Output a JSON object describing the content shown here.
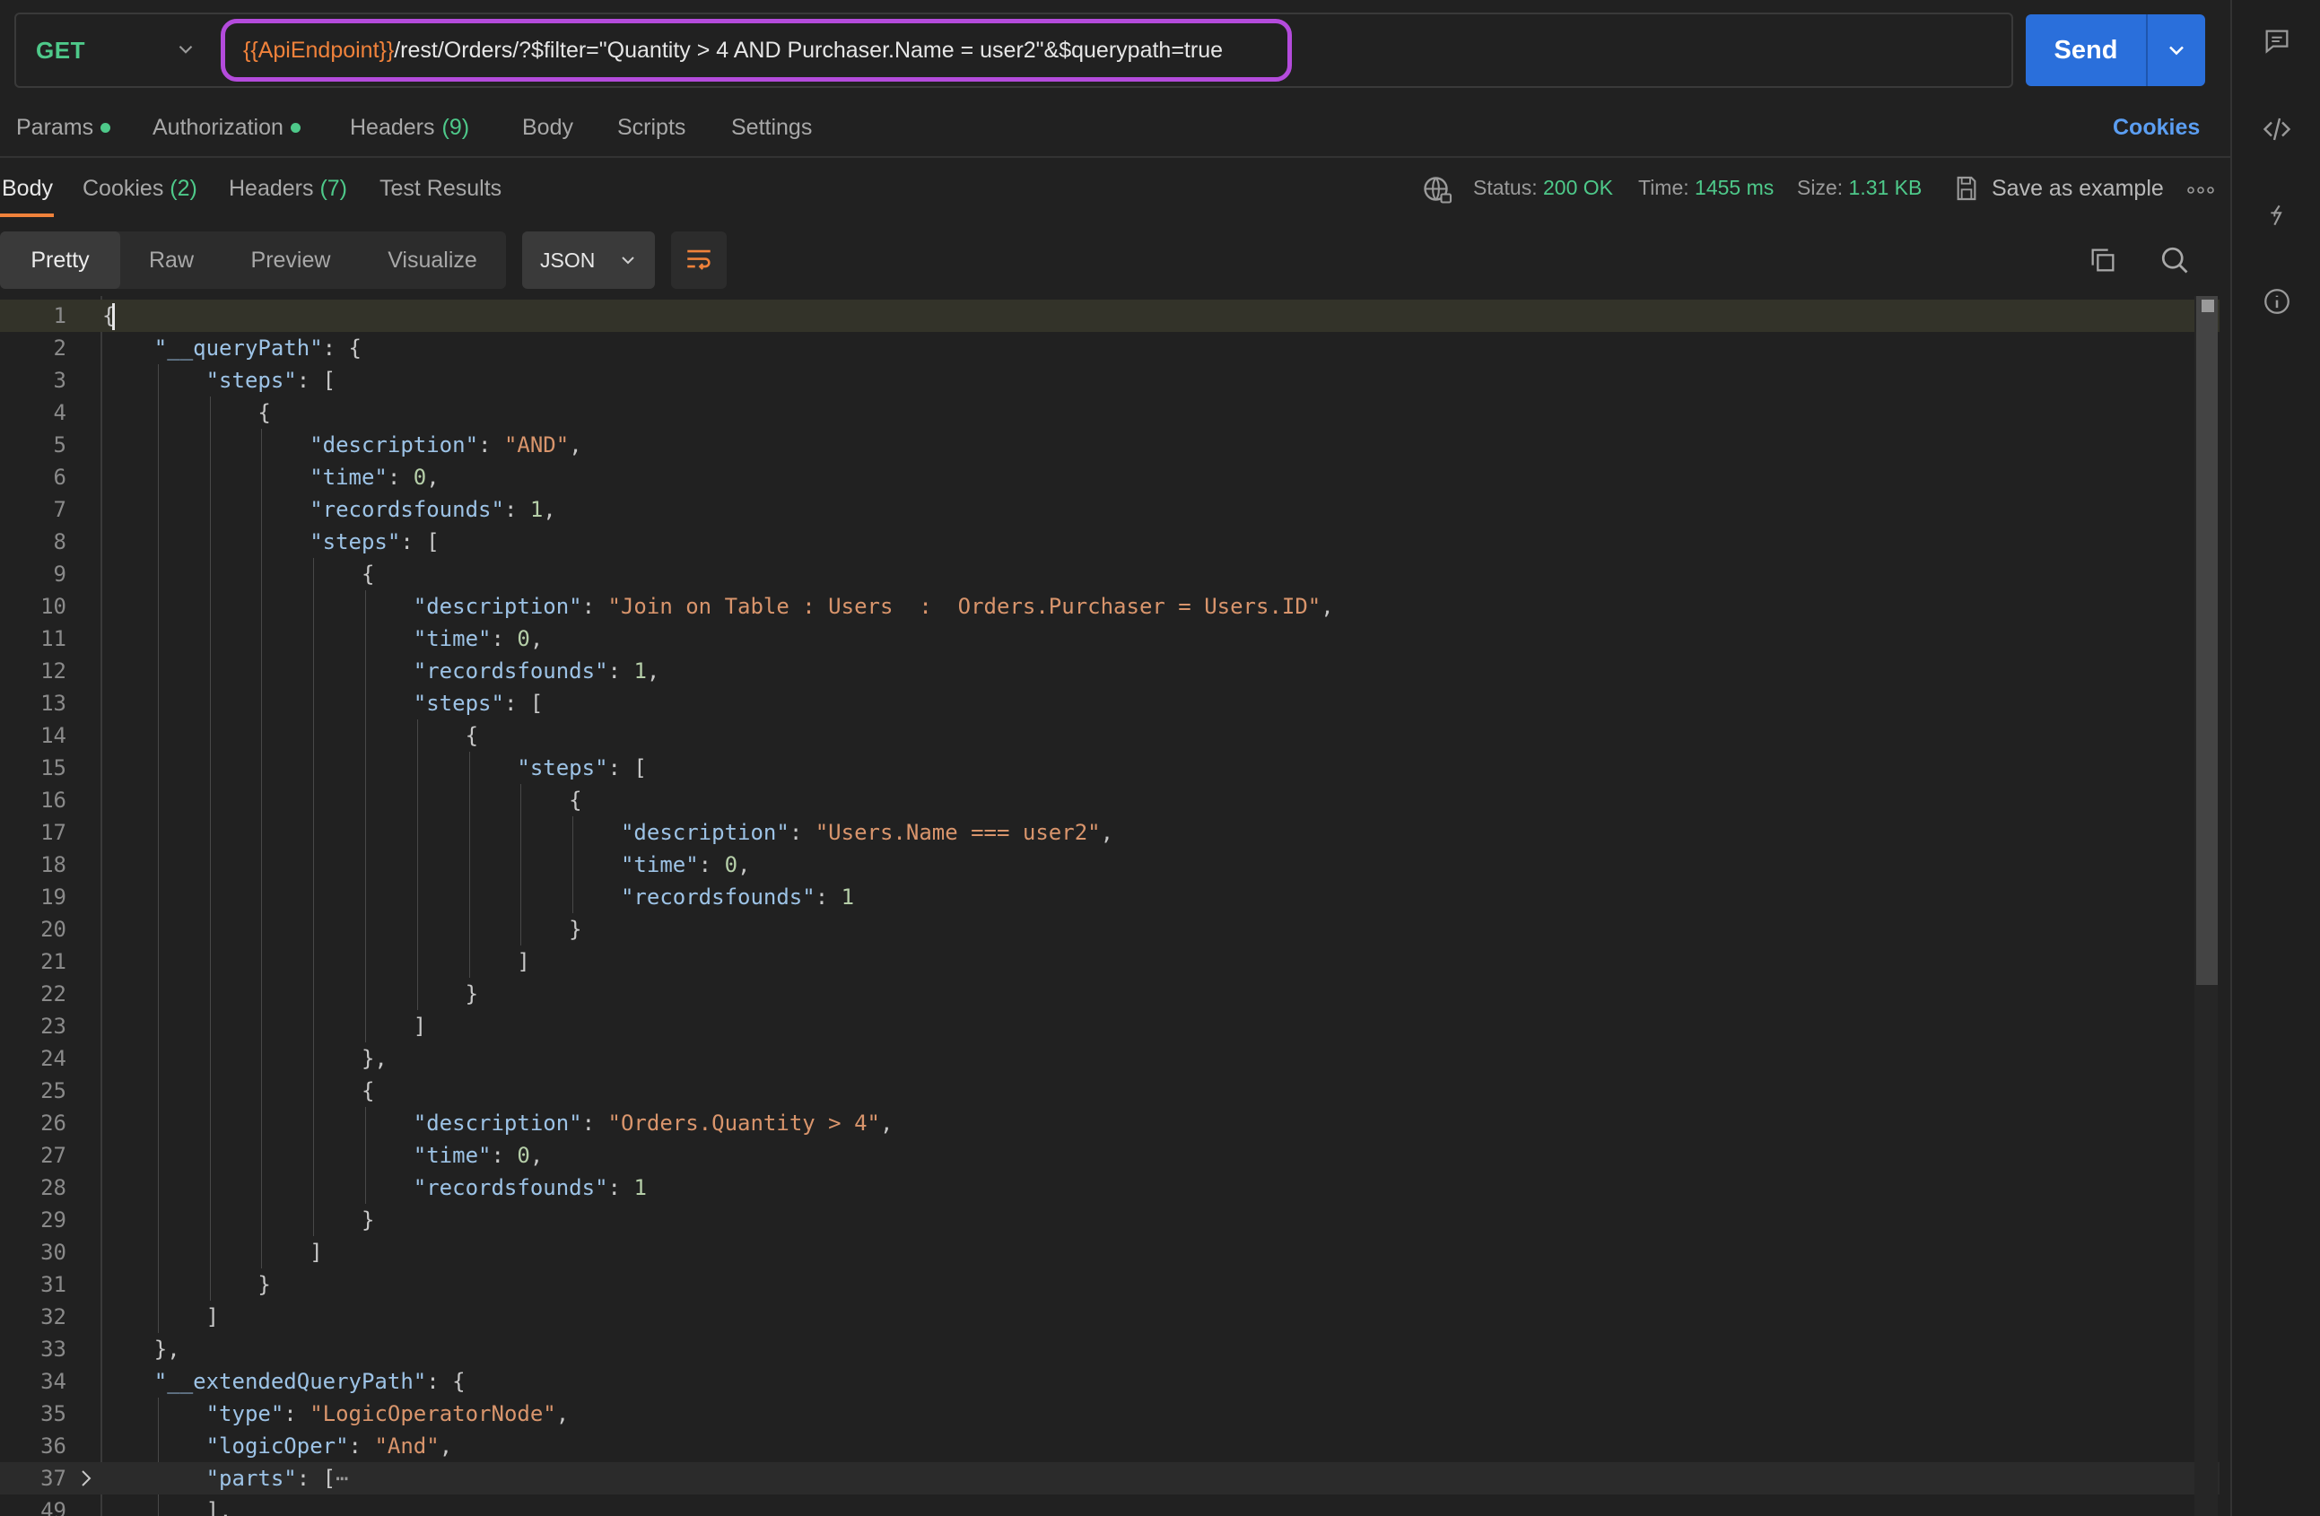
{
  "request": {
    "method": "GET",
    "url_var": "{{ApiEndpoint}}",
    "url_path": "/rest/Orders/?$filter=\"Quantity > 4 AND Purchaser.Name = user2\"&$querypath=true",
    "send_label": "Send"
  },
  "request_tabs": [
    {
      "label": "Params",
      "dot": true,
      "count": ""
    },
    {
      "label": "Authorization",
      "dot": true,
      "count": ""
    },
    {
      "label": "Headers",
      "dot": false,
      "count": "(9)"
    },
    {
      "label": "Body",
      "dot": false,
      "count": ""
    },
    {
      "label": "Scripts",
      "dot": false,
      "count": ""
    },
    {
      "label": "Settings",
      "dot": false,
      "count": ""
    }
  ],
  "cookies_link": "Cookies",
  "response_tabs": [
    {
      "label": "Body",
      "count": ""
    },
    {
      "label": "Cookies",
      "count": "(2)"
    },
    {
      "label": "Headers",
      "count": "(7)"
    },
    {
      "label": "Test Results",
      "count": ""
    }
  ],
  "status": {
    "status_label": "Status:",
    "status_value": "200 OK",
    "time_label": "Time:",
    "time_value": "1455 ms",
    "size_label": "Size:",
    "size_value": "1.31 KB",
    "save_label": "Save as example"
  },
  "view_modes": [
    "Pretty",
    "Raw",
    "Preview",
    "Visualize"
  ],
  "format": "JSON",
  "colors": {
    "accent": "#f0823b",
    "send": "#2a6fdb",
    "success": "#4ec98a",
    "highlight": "#b44bdc"
  },
  "code_lines": [
    {
      "n": "1",
      "indent": 0,
      "toks": [
        [
          "p",
          "{"
        ]
      ]
    },
    {
      "n": "2",
      "indent": 1,
      "toks": [
        [
          "k",
          "\"__queryPath\""
        ],
        [
          "p",
          ": {"
        ]
      ]
    },
    {
      "n": "3",
      "indent": 2,
      "toks": [
        [
          "k",
          "\"steps\""
        ],
        [
          "p",
          ": ["
        ]
      ]
    },
    {
      "n": "4",
      "indent": 3,
      "toks": [
        [
          "p",
          "{"
        ]
      ]
    },
    {
      "n": "5",
      "indent": 4,
      "toks": [
        [
          "k",
          "\"description\""
        ],
        [
          "p",
          ": "
        ],
        [
          "s",
          "\"AND\""
        ],
        [
          "p",
          ","
        ]
      ]
    },
    {
      "n": "6",
      "indent": 4,
      "toks": [
        [
          "k",
          "\"time\""
        ],
        [
          "p",
          ": "
        ],
        [
          "n",
          "0"
        ],
        [
          "p",
          ","
        ]
      ]
    },
    {
      "n": "7",
      "indent": 4,
      "toks": [
        [
          "k",
          "\"recordsfounds\""
        ],
        [
          "p",
          ": "
        ],
        [
          "n",
          "1"
        ],
        [
          "p",
          ","
        ]
      ]
    },
    {
      "n": "8",
      "indent": 4,
      "toks": [
        [
          "k",
          "\"steps\""
        ],
        [
          "p",
          ": ["
        ]
      ]
    },
    {
      "n": "9",
      "indent": 5,
      "toks": [
        [
          "p",
          "{"
        ]
      ]
    },
    {
      "n": "10",
      "indent": 6,
      "toks": [
        [
          "k",
          "\"description\""
        ],
        [
          "p",
          ": "
        ],
        [
          "s",
          "\"Join on Table : Users  :  Orders.Purchaser = Users.ID\""
        ],
        [
          "p",
          ","
        ]
      ]
    },
    {
      "n": "11",
      "indent": 6,
      "toks": [
        [
          "k",
          "\"time\""
        ],
        [
          "p",
          ": "
        ],
        [
          "n",
          "0"
        ],
        [
          "p",
          ","
        ]
      ]
    },
    {
      "n": "12",
      "indent": 6,
      "toks": [
        [
          "k",
          "\"recordsfounds\""
        ],
        [
          "p",
          ": "
        ],
        [
          "n",
          "1"
        ],
        [
          "p",
          ","
        ]
      ]
    },
    {
      "n": "13",
      "indent": 6,
      "toks": [
        [
          "k",
          "\"steps\""
        ],
        [
          "p",
          ": ["
        ]
      ]
    },
    {
      "n": "14",
      "indent": 7,
      "toks": [
        [
          "p",
          "{"
        ]
      ]
    },
    {
      "n": "15",
      "indent": 8,
      "toks": [
        [
          "k",
          "\"steps\""
        ],
        [
          "p",
          ": ["
        ]
      ]
    },
    {
      "n": "16",
      "indent": 9,
      "toks": [
        [
          "p",
          "{"
        ]
      ]
    },
    {
      "n": "17",
      "indent": 10,
      "toks": [
        [
          "k",
          "\"description\""
        ],
        [
          "p",
          ": "
        ],
        [
          "s",
          "\"Users.Name === user2\""
        ],
        [
          "p",
          ","
        ]
      ]
    },
    {
      "n": "18",
      "indent": 10,
      "toks": [
        [
          "k",
          "\"time\""
        ],
        [
          "p",
          ": "
        ],
        [
          "n",
          "0"
        ],
        [
          "p",
          ","
        ]
      ]
    },
    {
      "n": "19",
      "indent": 10,
      "toks": [
        [
          "k",
          "\"recordsfounds\""
        ],
        [
          "p",
          ": "
        ],
        [
          "n",
          "1"
        ]
      ]
    },
    {
      "n": "20",
      "indent": 9,
      "toks": [
        [
          "p",
          "}"
        ]
      ]
    },
    {
      "n": "21",
      "indent": 8,
      "toks": [
        [
          "p",
          "]"
        ]
      ]
    },
    {
      "n": "22",
      "indent": 7,
      "toks": [
        [
          "p",
          "}"
        ]
      ]
    },
    {
      "n": "23",
      "indent": 6,
      "toks": [
        [
          "p",
          "]"
        ]
      ]
    },
    {
      "n": "24",
      "indent": 5,
      "toks": [
        [
          "p",
          "},"
        ]
      ]
    },
    {
      "n": "25",
      "indent": 5,
      "toks": [
        [
          "p",
          "{"
        ]
      ]
    },
    {
      "n": "26",
      "indent": 6,
      "toks": [
        [
          "k",
          "\"description\""
        ],
        [
          "p",
          ": "
        ],
        [
          "s",
          "\"Orders.Quantity > 4\""
        ],
        [
          "p",
          ","
        ]
      ]
    },
    {
      "n": "27",
      "indent": 6,
      "toks": [
        [
          "k",
          "\"time\""
        ],
        [
          "p",
          ": "
        ],
        [
          "n",
          "0"
        ],
        [
          "p",
          ","
        ]
      ]
    },
    {
      "n": "28",
      "indent": 6,
      "toks": [
        [
          "k",
          "\"recordsfounds\""
        ],
        [
          "p",
          ": "
        ],
        [
          "n",
          "1"
        ]
      ]
    },
    {
      "n": "29",
      "indent": 5,
      "toks": [
        [
          "p",
          "}"
        ]
      ]
    },
    {
      "n": "30",
      "indent": 4,
      "toks": [
        [
          "p",
          "]"
        ]
      ]
    },
    {
      "n": "31",
      "indent": 3,
      "toks": [
        [
          "p",
          "}"
        ]
      ]
    },
    {
      "n": "32",
      "indent": 2,
      "toks": [
        [
          "p",
          "]"
        ]
      ]
    },
    {
      "n": "33",
      "indent": 1,
      "toks": [
        [
          "p",
          "},"
        ]
      ]
    },
    {
      "n": "34",
      "indent": 1,
      "toks": [
        [
          "k",
          "\"__extendedQueryPath\""
        ],
        [
          "p",
          ": {"
        ]
      ]
    },
    {
      "n": "35",
      "indent": 2,
      "toks": [
        [
          "k",
          "\"type\""
        ],
        [
          "p",
          ": "
        ],
        [
          "s",
          "\"LogicOperatorNode\""
        ],
        [
          "p",
          ","
        ]
      ]
    },
    {
      "n": "36",
      "indent": 2,
      "toks": [
        [
          "k",
          "\"logicOper\""
        ],
        [
          "p",
          ": "
        ],
        [
          "s",
          "\"And\""
        ],
        [
          "p",
          ","
        ]
      ]
    },
    {
      "n": "37",
      "indent": 2,
      "folded": true,
      "toks": [
        [
          "k",
          "\"parts\""
        ],
        [
          "p",
          ": ["
        ],
        [
          "ellipsis",
          "⋯"
        ]
      ]
    },
    {
      "n": "49",
      "indent": 2,
      "toks": [
        [
          "p",
          "],"
        ]
      ]
    }
  ]
}
